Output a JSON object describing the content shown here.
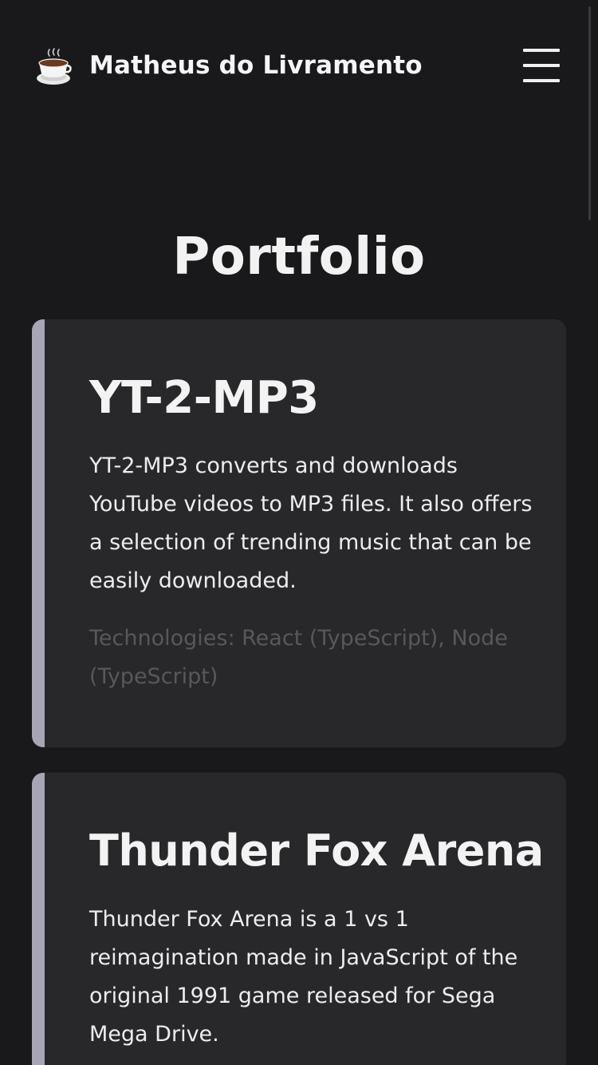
{
  "header": {
    "logo_icon": "coffee-cup-icon",
    "brand_name": "Matheus do Livramento",
    "menu_icon": "hamburger-menu-icon"
  },
  "main": {
    "page_title": "Portfolio",
    "projects": [
      {
        "title": "YT-2-MP3",
        "description": "YT-2-MP3 converts and downloads YouTube videos to MP3 files. It also offers a selection of trending music that can be easily downloaded.",
        "technologies": "Technologies: React (TypeScript), Node (TypeScript)"
      },
      {
        "title": "Thunder Fox Arena",
        "description": "Thunder Fox Arena is a 1 vs 1 reimagination made in JavaScript of the original 1991 game released for Sega Mega Drive."
      }
    ]
  },
  "colors": {
    "background": "#19191b",
    "card": "#28282b",
    "accent_bar": "#a7a5b6",
    "muted_text": "#58585c"
  }
}
